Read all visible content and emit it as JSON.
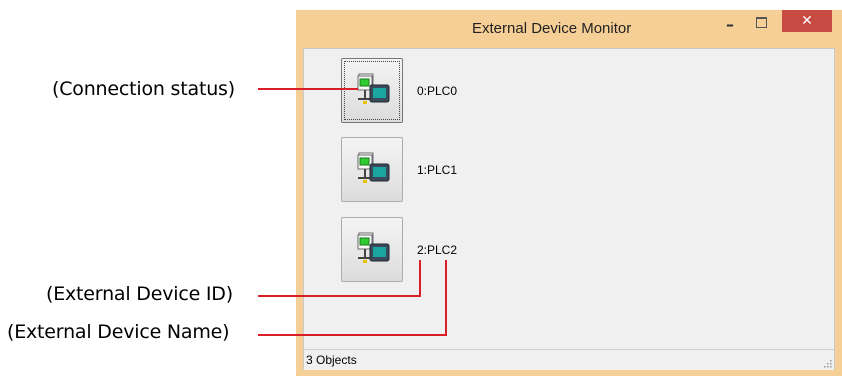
{
  "window": {
    "title": "External Device Monitor",
    "minimize_glyph": "–",
    "close_glyph": "✕"
  },
  "devices": [
    {
      "label": "0:PLC0",
      "icon": "network-device-icon",
      "focused": true
    },
    {
      "label": "1:PLC1",
      "icon": "network-device-icon",
      "focused": false
    },
    {
      "label": "2:PLC2",
      "icon": "network-device-icon",
      "focused": false
    }
  ],
  "statusbar": {
    "text": "3 Objects"
  },
  "callouts": {
    "connection_status": "(Connection status)",
    "device_id": "(External Device ID)",
    "device_name": "(External Device Name)"
  },
  "colors": {
    "callout_line": "#d91e2a",
    "window_frame": "#f6cf96",
    "close_button": "#c74a43"
  }
}
